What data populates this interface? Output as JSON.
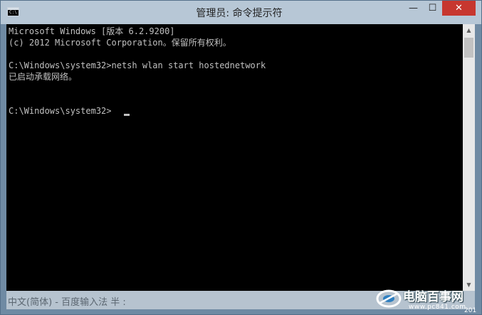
{
  "window": {
    "title": "管理员: 命令提示符",
    "icon_text": "C:\\",
    "minimize_icon": "minimize-icon",
    "maximize_icon": "maximize-icon",
    "close_icon": "close-icon",
    "minimize_glyph": "—",
    "maximize_glyph": "☐",
    "close_glyph": "✕"
  },
  "console": {
    "lines": [
      "Microsoft Windows [版本 6.2.9200]",
      "(c) 2012 Microsoft Corporation。保留所有权利。",
      "",
      "C:\\Windows\\system32>netsh wlan start hostednetwork",
      "已启动承载网络。",
      "",
      "",
      "C:\\Windows\\system32>"
    ],
    "text_color": "#c0c0c0",
    "background": "#000000"
  },
  "scrollbar": {
    "up_glyph": "▲",
    "down_glyph": "▼"
  },
  "ime": {
    "status": "中文(简体) - 百度输入法 半 :"
  },
  "watermark": {
    "brand": "电脑百事网",
    "url": "www.pc841.com",
    "year": "201"
  },
  "colors": {
    "titlebar": "#b7c7d6",
    "close_button": "#c7372f",
    "frame": "#6f8aa3"
  }
}
